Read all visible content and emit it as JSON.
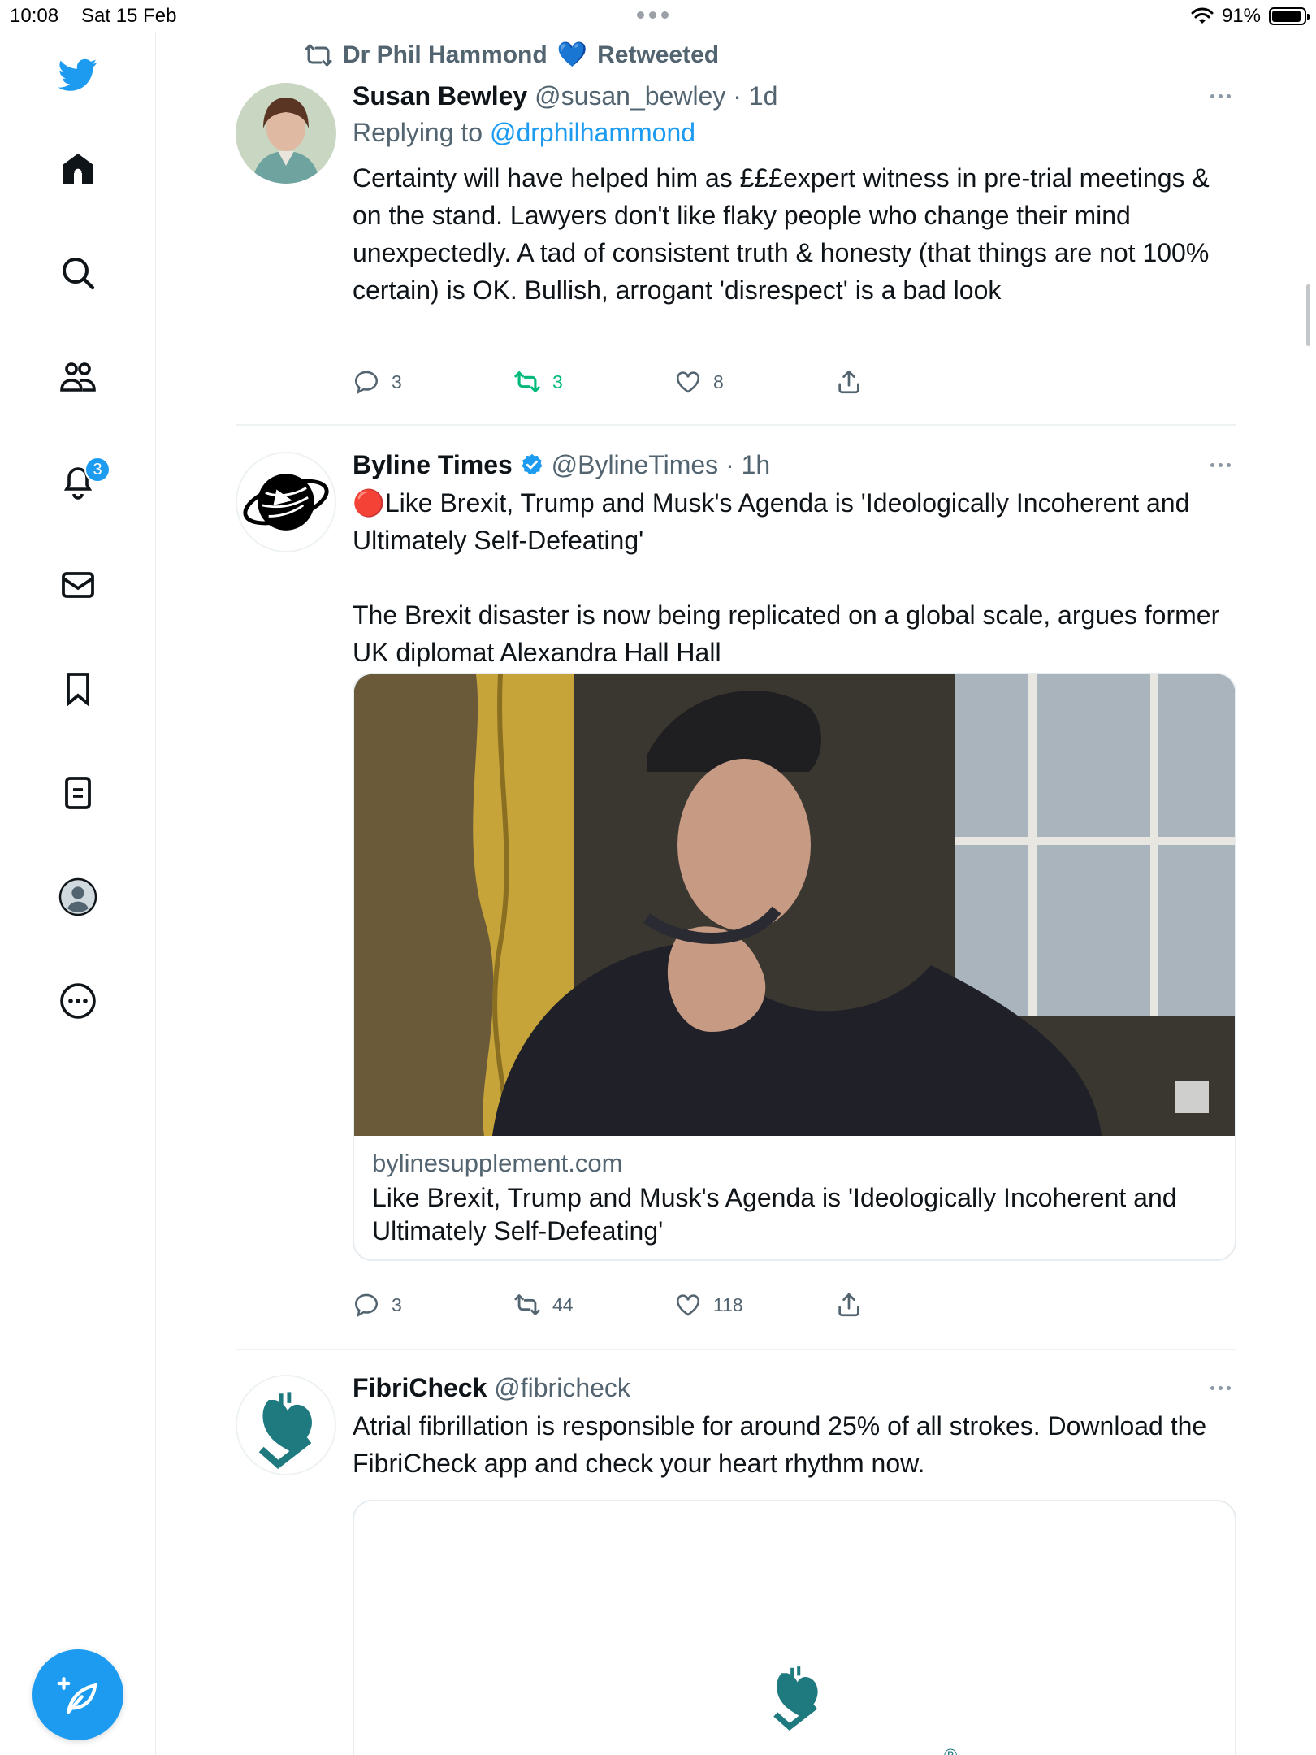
{
  "status_bar": {
    "time": "10:08",
    "date": "Sat 15 Feb",
    "battery": "91%",
    "battery_level": 0.91
  },
  "sidebar": {
    "items": [
      {
        "icon": "bird-logo-icon"
      },
      {
        "icon": "home-icon"
      },
      {
        "icon": "search-icon"
      },
      {
        "icon": "communities-icon"
      },
      {
        "icon": "notifications-bell-icon",
        "badge": "3"
      },
      {
        "icon": "messages-icon"
      },
      {
        "icon": "bookmark-icon"
      },
      {
        "icon": "lists-icon"
      },
      {
        "icon": "profile-icon"
      },
      {
        "icon": "more-options-icon"
      }
    ],
    "compose_icon": "compose-feather-icon"
  },
  "colors": {
    "accent": "#1d9bf0",
    "retweet_green": "#00ba7c",
    "muted": "#536471",
    "text": "#0f1419"
  },
  "tweets": [
    {
      "social_context": {
        "name": "Dr Phil Hammond",
        "emoji": "💙",
        "suffix": "Retweeted"
      },
      "display_name": "Susan Bewley",
      "handle": "@susan_bewley",
      "time": "· 1d",
      "replying_prefix": "Replying to",
      "replying_handle": "@drphilhammond",
      "text": "Certainty will have helped him as £££expert witness in pre-trial meetings & on the stand. Lawyers don't like flaky people who change their mind unexpectedly. A tad of consistent truth & honesty (that things are not 100% certain) is OK. Bullish, arrogant 'disrespect' is a bad look",
      "replies": "3",
      "retweets": "3",
      "likes": "8"
    },
    {
      "display_name": "Byline Times",
      "handle": "@BylineTimes",
      "time": "· 1h",
      "text_line1": "🔴Like Brexit, Trump and Musk's Agenda is 'Ideologically Incoherent and Ultimately Self-Defeating'",
      "text_line2": "The Brexit disaster is now being replicated on a global scale, argues former UK diplomat Alexandra Hall Hall",
      "card": {
        "domain": "bylinesupplement.com",
        "title": "Like Brexit, Trump and Musk's Agenda is 'Ideologically Incoherent and Ultimately Self-Defeating'"
      },
      "replies": "3",
      "retweets": "44",
      "likes": "118"
    },
    {
      "display_name": "FibriCheck",
      "handle": "@fibricheck",
      "text": "Atrial fibrillation is responsible for around 25% of all strokes. Download the FibriCheck app and check your heart rhythm now.",
      "card_mark": "®"
    }
  ]
}
